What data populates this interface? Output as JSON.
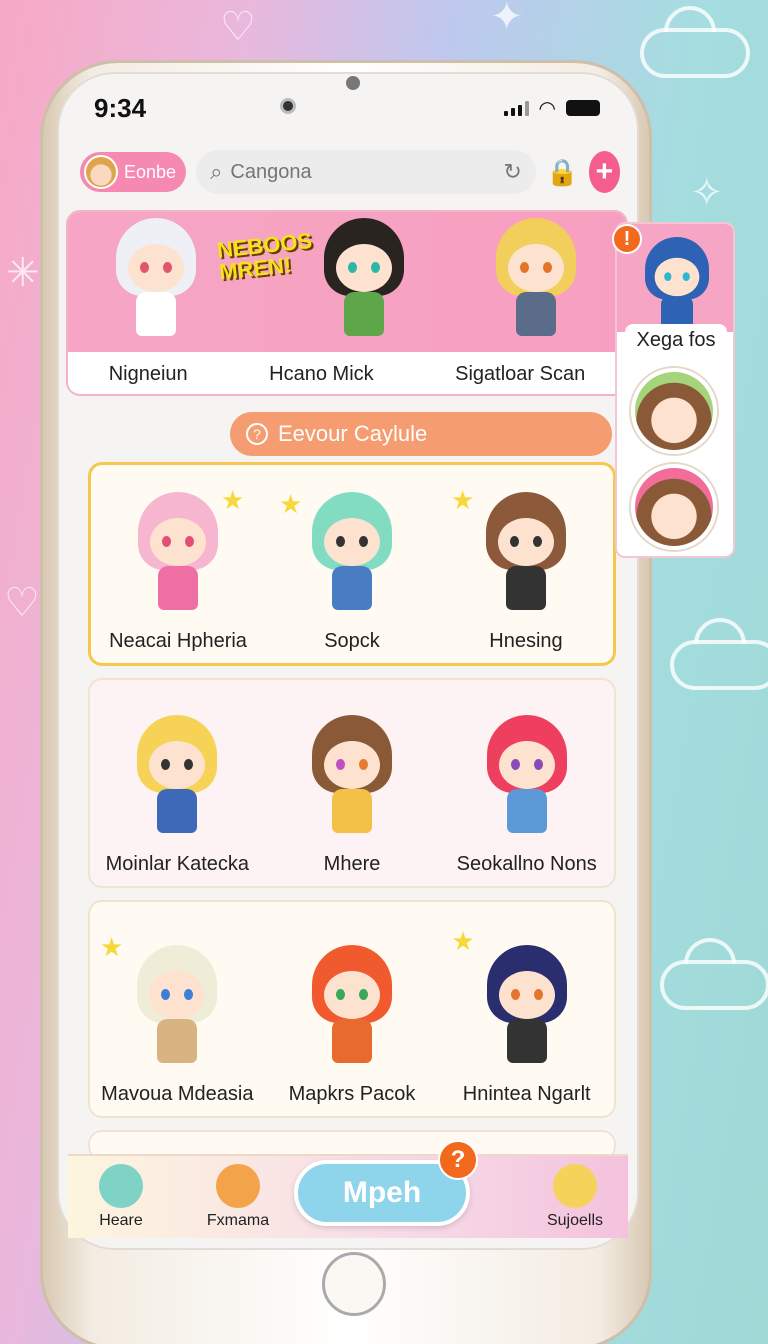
{
  "status": {
    "time": "9:34"
  },
  "header": {
    "profile_label": "Eonbe",
    "search_placeholder": "Cangona"
  },
  "banner": {
    "title": "NEBOOS MREN!",
    "names": [
      "Nigneiun",
      "Hcano Mick",
      "Sigatloar Scan"
    ]
  },
  "section_pill": {
    "label": "Eevour Caylule"
  },
  "grid": {
    "rows": [
      [
        "Neacai Hpheria",
        "Sopck",
        "Hnesing"
      ],
      [
        "Moinlar Katecka",
        "Mhere",
        "Seokallno Nons"
      ],
      [
        "Mavoua Mdeasia",
        "Mapkrs Pacok",
        "Hnintea Ngarlt"
      ]
    ]
  },
  "side_panel": {
    "name": "Xega fos",
    "alert": "!"
  },
  "bottom_nav": {
    "items": [
      "Heare",
      "Fxmama",
      "Sujoells"
    ],
    "center_button": "Mpeh",
    "center_badge": "?"
  },
  "colors": {
    "accent_pink": "#f55d8e",
    "pill_orange": "#f59c70",
    "center_button": "#8ed4ea"
  }
}
